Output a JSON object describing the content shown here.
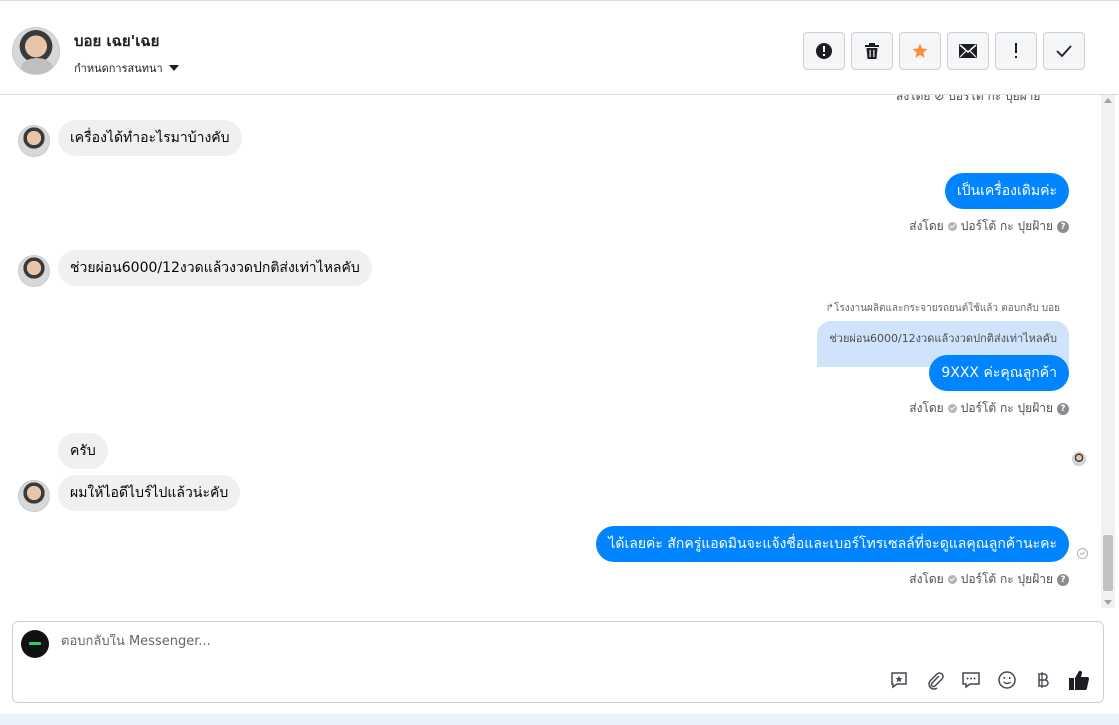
{
  "header": {
    "contact_name": "บอย เฉย'เฉย",
    "assign_label": "กำหนดการสนทนา",
    "toolbar": [
      {
        "name": "spam-alert-button",
        "icon": "alert-circle-icon"
      },
      {
        "name": "delete-button",
        "icon": "trash-icon"
      },
      {
        "name": "star-button",
        "icon": "star-icon"
      },
      {
        "name": "mark-unread-button",
        "icon": "envelope-icon"
      },
      {
        "name": "follow-up-button",
        "icon": "exclamation-icon"
      },
      {
        "name": "mark-done-button",
        "icon": "checkmark-icon"
      }
    ]
  },
  "messages": {
    "top_sent_by": "ส่งโดย ⊘ ปอร์โต้ กะ ปุยฝ้าย",
    "m1": "เครื่องได้ทำอะไรมาบ้างคับ",
    "m2": "เป็นเครื่องเดิมค่ะ",
    "m2_sent_by_prefix": "ส่งโดย",
    "m2_sent_by_name": "ปอร์โต้ กะ ปุยฝ้าย",
    "m3": "ช่วยผ่อน6000/12งวดแล้วงวดปกติส่งเท่าไหลคับ",
    "reply_meta": "↱โรงงานผลิตและกระจายรถยนต์ใช้แล้ว ตอบกลับ บอย",
    "quoted_text": "ช่วยผ่อน6000/12งวดแล้วงวดปกติส่งเท่าไหลคับ",
    "m4": "9XXX ค่ะคุณลูกค้า",
    "m4_sent_by_prefix": "ส่งโดย",
    "m4_sent_by_name": "ปอร์โต้ กะ ปุยฝ้าย",
    "m5": "ครับ",
    "m6": "ผมให้ไอดีไบร์ไปแล้วน่ะคับ",
    "m7": "ได้เลยค่ะ สักครู่แอดมินจะแจ้งชื่อและเบอร์โทรเซลล์ที่จะดูแลคุณลูกค้านะคะ",
    "m7_sent_by_prefix": "ส่งโดย",
    "m7_sent_by_name": "ปอร์โต้ กะ ปุยฝ้าย"
  },
  "composer": {
    "placeholder": "ตอบกลับใน Messenger...",
    "tools": [
      "saved-reply-icon",
      "attachment-icon",
      "chat-bubble-icon",
      "emoji-icon",
      "baht-icon",
      "thumbs-up-icon"
    ]
  },
  "colors": {
    "outgoing_bubble": "#0084ff",
    "incoming_bubble": "#f0f0f0",
    "quoted_bubble": "#cfe3fb",
    "star": "#f7923b"
  }
}
